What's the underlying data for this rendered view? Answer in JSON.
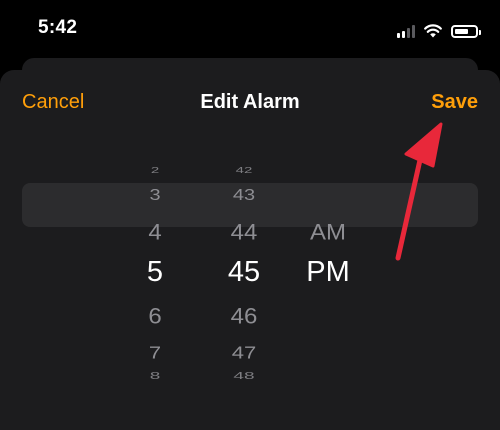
{
  "status_bar": {
    "time": "5:42",
    "icons": [
      "cellular-signal-icon",
      "wifi-icon",
      "battery-icon"
    ]
  },
  "nav": {
    "cancel_label": "Cancel",
    "title": "Edit Alarm",
    "save_label": "Save"
  },
  "picker": {
    "hours": {
      "items": [
        "2",
        "3",
        "4",
        "5",
        "6",
        "7",
        "8"
      ],
      "selected": "5"
    },
    "minutes": {
      "items": [
        "42",
        "43",
        "44",
        "45",
        "46",
        "47",
        "48"
      ],
      "selected": "45"
    },
    "period": {
      "items": [
        "AM",
        "PM"
      ],
      "selected": "PM"
    }
  },
  "colors": {
    "accent": "#ff9f0a",
    "sheet_background": "#1c1c1e",
    "selection_band": "#2c2c2e",
    "secondary_text": "#8e8e93",
    "annotation_arrow": "#e8283a"
  }
}
